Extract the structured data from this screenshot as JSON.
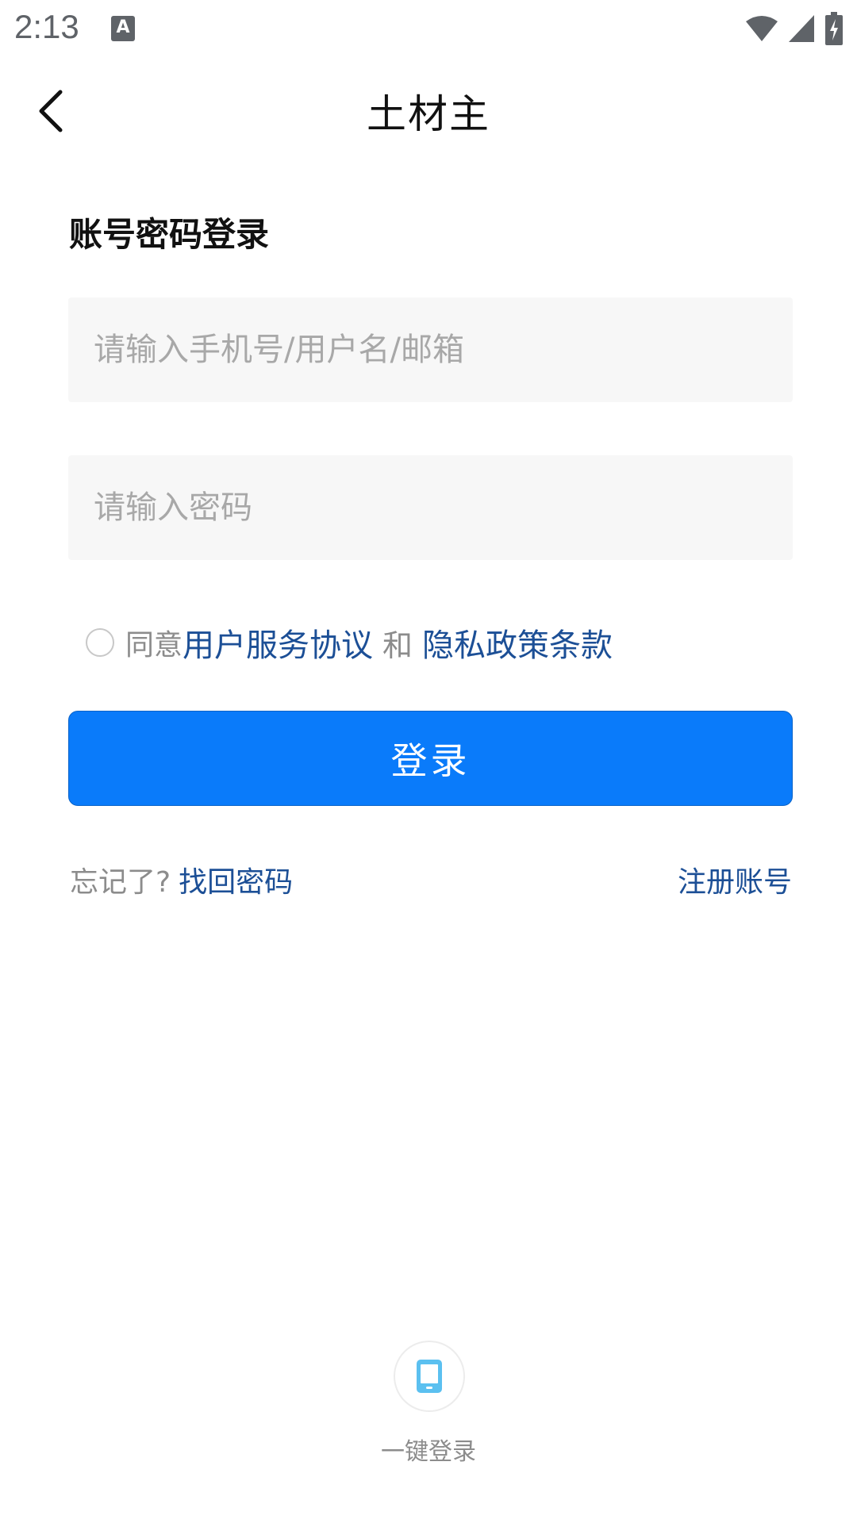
{
  "status_bar": {
    "time": "2:13",
    "notification_icon": "a-icon",
    "wifi_icon": "wifi-icon",
    "signal_icon": "signal-icon",
    "battery_icon": "battery-charging-icon"
  },
  "header": {
    "title": "土材主",
    "back_icon": "chevron-left-icon"
  },
  "login": {
    "section_title": "账号密码登录",
    "account_placeholder": "请输入手机号/用户名/邮箱",
    "password_placeholder": "请输入密码",
    "agreement": {
      "agree_text": "同意",
      "user_agreement": "用户服务协议",
      "and_text": "和",
      "privacy_policy": "隐私政策条款"
    },
    "button_label": "登录",
    "forgot_label": "忘记了?",
    "find_password": "找回密码",
    "register": "注册账号"
  },
  "one_key": {
    "icon": "phone-icon",
    "label": "一键登录"
  },
  "colors": {
    "primary": "#0a7bfa",
    "link": "#1c4f96",
    "input_bg": "#f7f7f7",
    "muted_text": "#8c8c8c"
  }
}
